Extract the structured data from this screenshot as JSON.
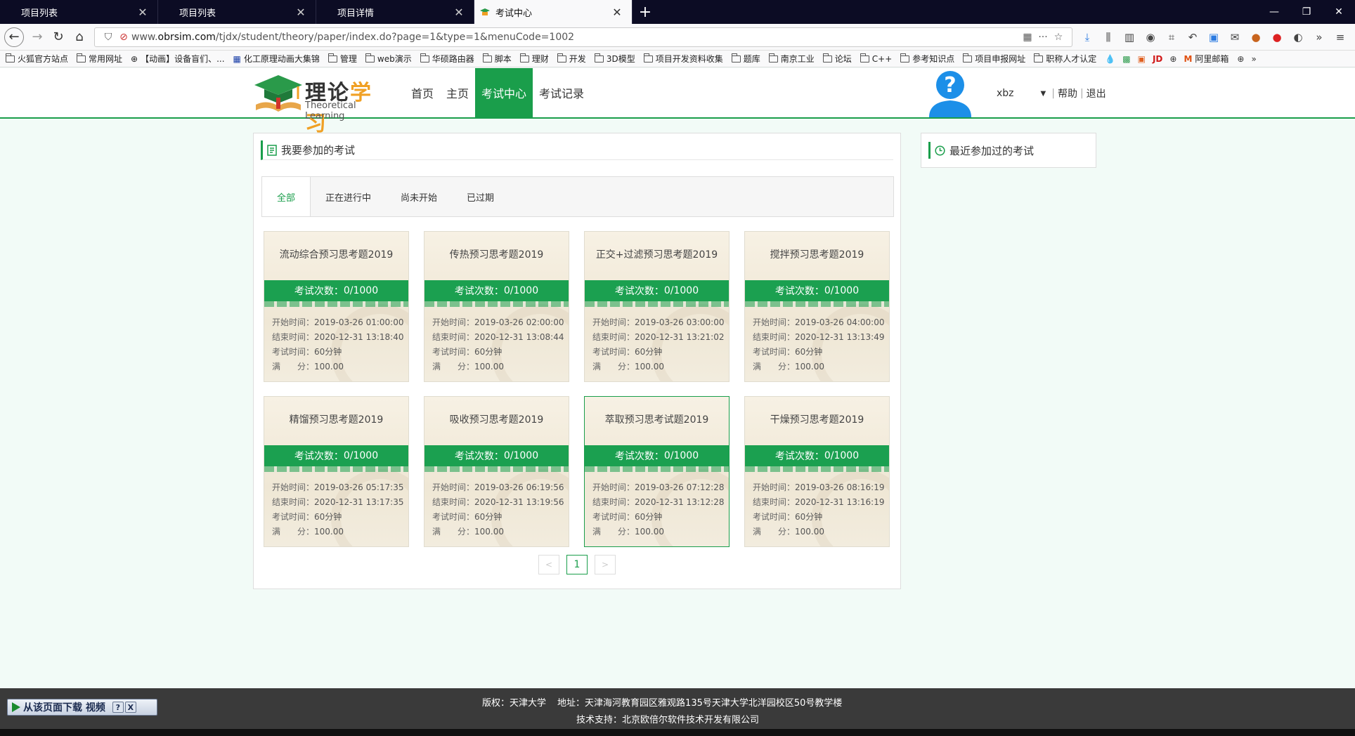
{
  "browser": {
    "tabs": [
      {
        "title": "项目列表",
        "active": false
      },
      {
        "title": "项目列表",
        "active": false
      },
      {
        "title": "项目详情",
        "active": false
      },
      {
        "title": "考试中心",
        "active": true
      }
    ],
    "url_prefix": "www.",
    "url_domain": "obrsim.com",
    "url_path": "/tjdx/student/theory/paper/index.do?page=1&type=1&menuCode=1002",
    "bookmarks": [
      "火狐官方站点",
      "常用网址",
      "【动画】设备盲们、...",
      "化工原理动画大集锦",
      "管理",
      "web演示",
      "华硕路由器",
      "脚本",
      "理财",
      "开发",
      "3D模型",
      "项目开发资料收集",
      "题库",
      "南京工业",
      "论坛",
      "C++",
      "参考知识点",
      "项目申报网址",
      "职称人才认定",
      "阿里邮箱"
    ]
  },
  "site": {
    "logo_cn_a": "理论",
    "logo_cn_b": "学习",
    "logo_en": "Theoretical Learning",
    "nav": [
      "首页",
      "主页",
      "考试中心",
      "考试记录"
    ],
    "nav_active_index": 2,
    "username": "xbz",
    "help": "帮助",
    "logout": "退出",
    "accent_color": "#1a9e4b"
  },
  "main": {
    "panel_title": "我要参加的考试",
    "filter_tabs": [
      "全部",
      "正在进行中",
      "尚未开始",
      "已过期"
    ],
    "labels": {
      "count": "考试次数：",
      "start": "开始时间：",
      "end": "结束时间：",
      "duration": "考试时间：",
      "score": "满　　分："
    },
    "exams": [
      {
        "title": "流动综合预习思考题2019",
        "count": "0/1000",
        "start": "2019-03-26 01:00:00",
        "end": "2020-12-31 13:18:40",
        "duration": "60分钟",
        "score": "100.00"
      },
      {
        "title": "传热预习思考题2019",
        "count": "0/1000",
        "start": "2019-03-26 02:00:00",
        "end": "2020-12-31 13:08:44",
        "duration": "60分钟",
        "score": "100.00"
      },
      {
        "title": "正交+过滤预习思考题2019",
        "count": "0/1000",
        "start": "2019-03-26 03:00:00",
        "end": "2020-12-31 13:21:02",
        "duration": "60分钟",
        "score": "100.00"
      },
      {
        "title": "搅拌预习思考题2019",
        "count": "0/1000",
        "start": "2019-03-26 04:00:00",
        "end": "2020-12-31 13:13:49",
        "duration": "60分钟",
        "score": "100.00"
      },
      {
        "title": "精馏预习思考题2019",
        "count": "0/1000",
        "start": "2019-03-26 05:17:35",
        "end": "2020-12-31 13:17:35",
        "duration": "60分钟",
        "score": "100.00"
      },
      {
        "title": "吸收预习思考题2019",
        "count": "0/1000",
        "start": "2019-03-26 06:19:56",
        "end": "2020-12-31 13:19:56",
        "duration": "60分钟",
        "score": "100.00"
      },
      {
        "title": "萃取预习思考试题2019",
        "count": "0/1000",
        "start": "2019-03-26 07:12:28",
        "end": "2020-12-31 13:12:28",
        "duration": "60分钟",
        "score": "100.00"
      },
      {
        "title": "干燥预习思考题2019",
        "count": "0/1000",
        "start": "2019-03-26 08:16:19",
        "end": "2020-12-31 13:16:19",
        "duration": "60分钟",
        "score": "100.00"
      }
    ],
    "pager": {
      "prev": "<",
      "current": "1",
      "next": ">"
    }
  },
  "side": {
    "title": "最近参加过的考试"
  },
  "footer": {
    "copyright_label": "版权：",
    "copyright": "天津大学",
    "address_label": "地址：",
    "address": "天津海河教育园区雅观路135号天津大学北洋园校区50号教学楼",
    "support_label": "技术支持：",
    "support": "北京欧倍尔软件技术开发有限公司"
  },
  "download_widget": {
    "label": "从该页面下载 视频",
    "help": "?",
    "close": "X"
  }
}
